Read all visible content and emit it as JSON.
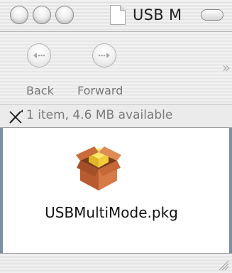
{
  "window": {
    "title": "USB M",
    "buttons": [
      "close",
      "minimize",
      "zoom"
    ]
  },
  "toolbar": {
    "back_label": "Back",
    "forward_label": "Forward",
    "overflow_glyph": "»"
  },
  "status": {
    "text": "1 item, 4.6 MB available",
    "icon": "pencil-crossed-icon"
  },
  "content": {
    "items": [
      {
        "name": "USBMultiMode.pkg",
        "icon": "package-icon"
      }
    ]
  },
  "colors": {
    "content_border": "#7d8fa4",
    "package_box": "#c86a3b",
    "package_lid": "#f0d24a"
  }
}
